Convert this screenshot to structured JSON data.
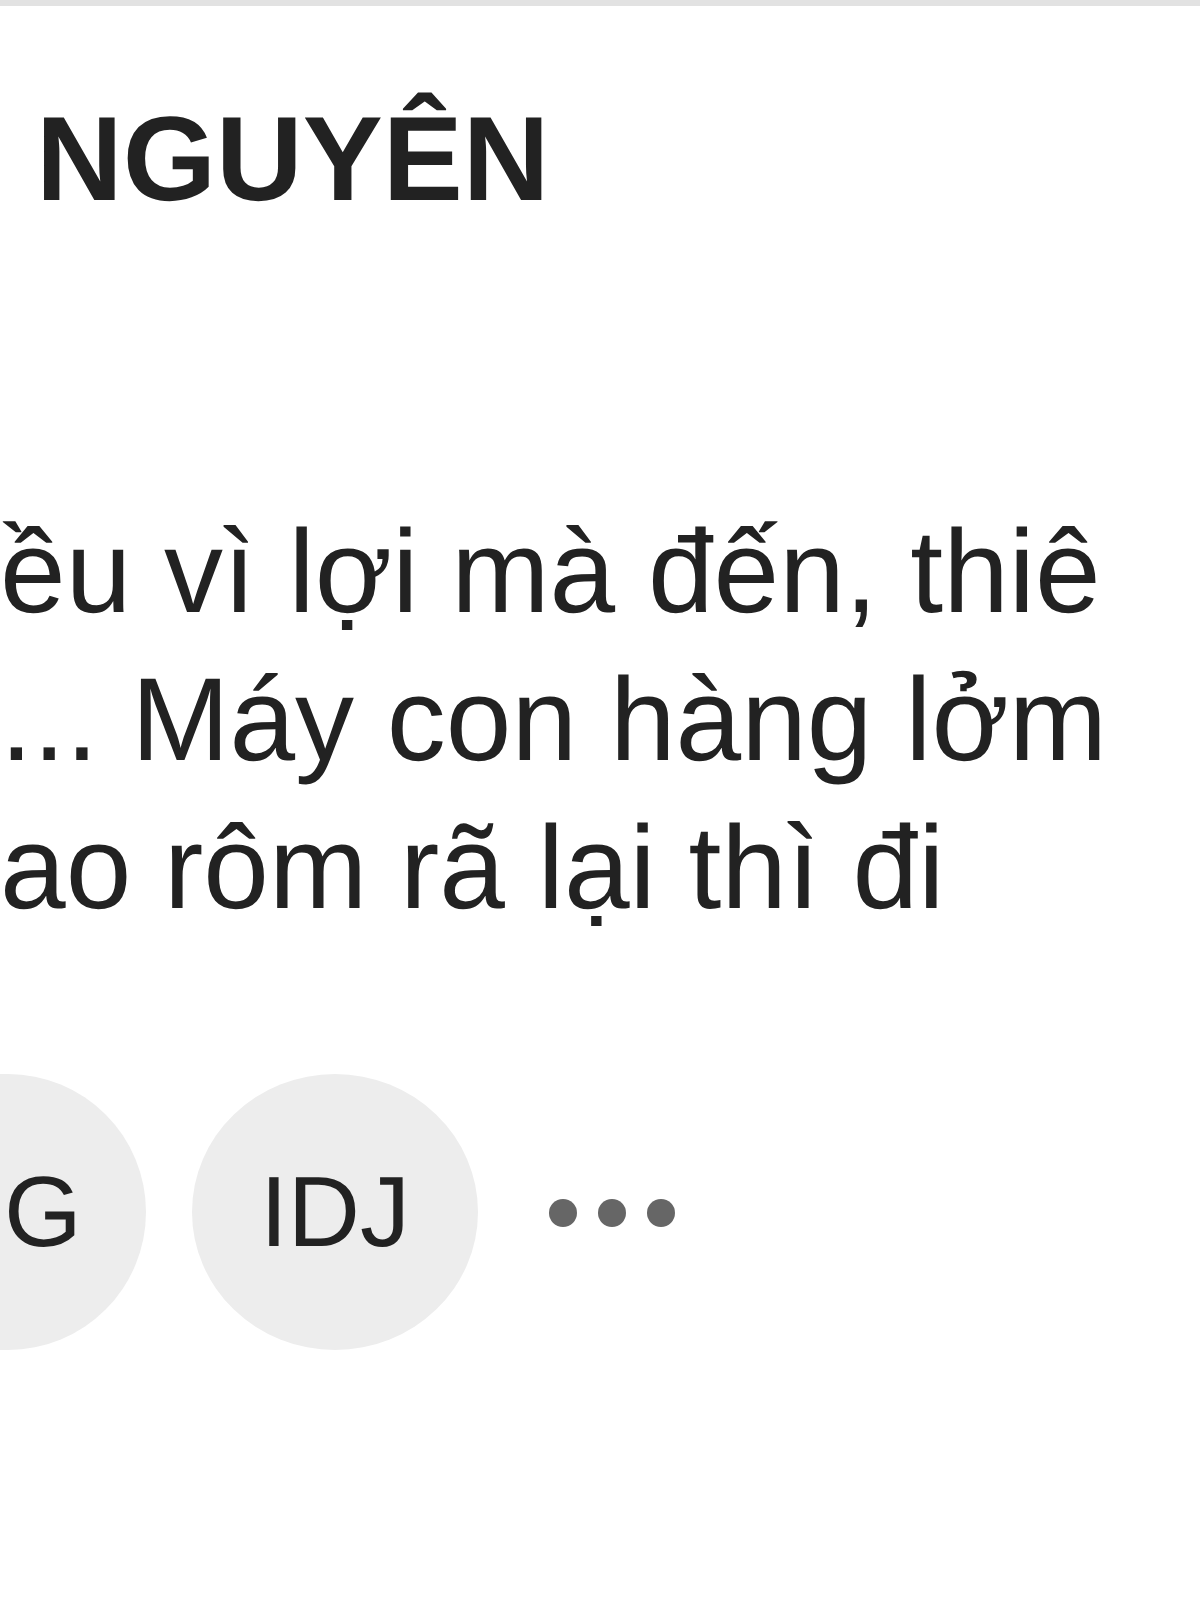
{
  "header": {
    "title": "NGUYÊN"
  },
  "post": {
    "lines": [
      "ều vì lợi mà đến, thiê",
      "... Máy con hàng lởm",
      "ao rôm rã lại thì đi"
    ]
  },
  "tags": [
    {
      "label": "G",
      "kind": "cut"
    },
    {
      "label": "IDJ",
      "kind": "full"
    }
  ]
}
